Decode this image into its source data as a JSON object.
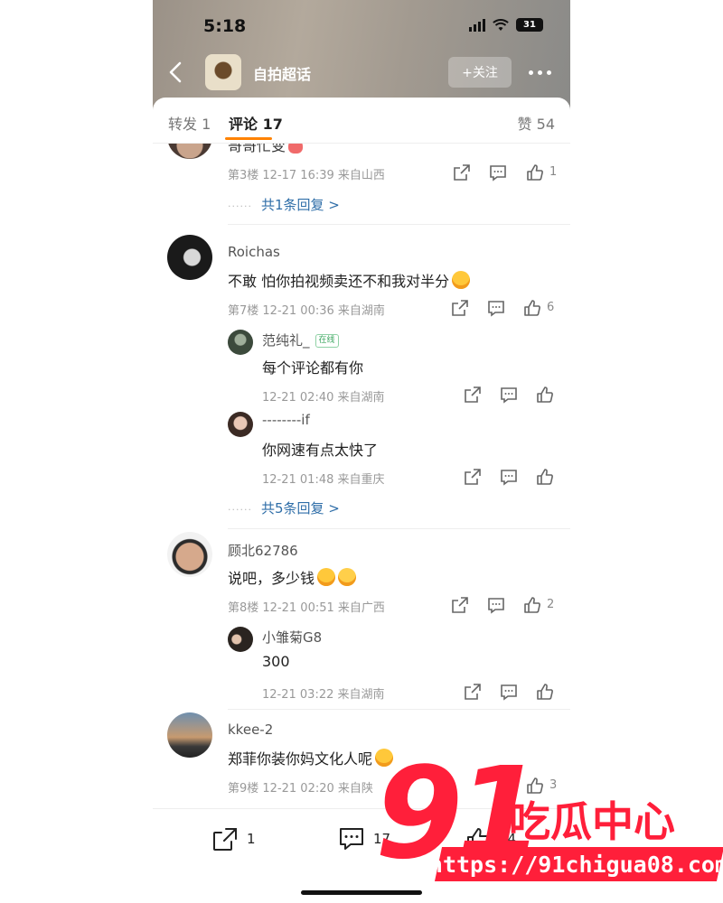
{
  "status": {
    "time": "5:18",
    "battery": "31"
  },
  "header": {
    "title": "自拍超话",
    "follow_label": "+关注"
  },
  "tabs": {
    "forward": "转发 1",
    "comments": "评论 17",
    "likes": "赞 54"
  },
  "comments": [
    {
      "name": "",
      "text": "哥哥忙变",
      "meta": "第3楼 12-17 16:39 来自山西",
      "likes": "1",
      "replies_link": "共1条回复 >",
      "replies": []
    },
    {
      "name": "Roichas",
      "text": "不敢 怕你拍视频卖还不和我对半分",
      "meta": "第7楼 12-21 00:36 来自湖南",
      "likes": "6",
      "replies_link": "共5条回复 >",
      "replies": [
        {
          "name": "范纯礼_",
          "badge": "在线",
          "text": "每个评论都有你",
          "meta": "12-21 02:40 来自湖南"
        },
        {
          "name": "--------if",
          "badge": "",
          "text": "你网速有点太快了",
          "meta": "12-21 01:48 来自重庆"
        }
      ]
    },
    {
      "name": "顾北62786",
      "text": "说吧，多少钱",
      "meta": "第8楼 12-21 00:51 来自广西",
      "likes": "2",
      "replies_link": "",
      "replies": [
        {
          "name": "小雏菊G8",
          "badge": "",
          "text": "300",
          "meta": "12-21 03:22 来自湖南"
        }
      ]
    },
    {
      "name": "kkee-2",
      "text": "郑菲你装你妈文化人呢",
      "meta": "第9楼 12-21 02:20 来自陕",
      "likes": "3",
      "replies_link": "",
      "replies": []
    }
  ],
  "bottom_bar": {
    "forward_count": "1",
    "comment_count": "17",
    "like_count": "54"
  },
  "watermark": {
    "brand_number": "91",
    "brand_text": "吃瓜中心",
    "url": "https://91chigua08.com"
  },
  "colors": {
    "accent": "#ff8200",
    "link": "#2f6ea8",
    "watermark": "#ff1f3a"
  }
}
